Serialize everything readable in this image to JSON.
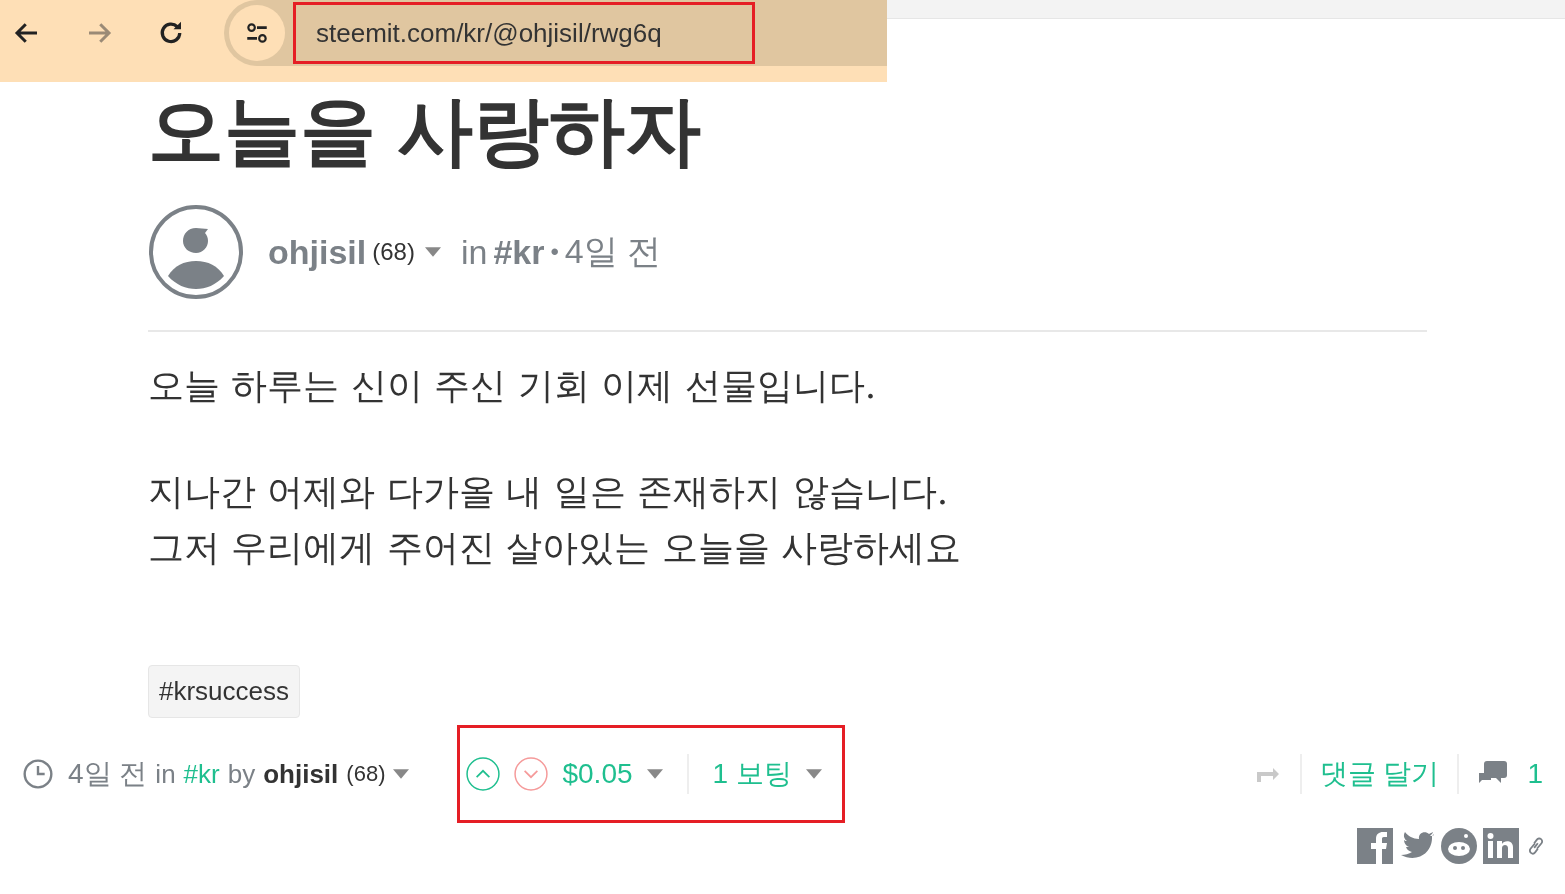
{
  "browser": {
    "url": "steemit.com/kr/@ohjisil/rwg6q",
    "url_highlighted": true
  },
  "post": {
    "title": "오늘을 사랑하자",
    "author": "ohjisil",
    "reputation": "(68)",
    "in": "in",
    "category": "#kr",
    "dot": "•",
    "time": "4일 전",
    "paragraphs": [
      [
        "오늘 하루는 신이 주신 기회 이제 선물입니다."
      ],
      [
        "지나간 어제와 다가올 내 일은 존재하지 않습니다.",
        "그저 우리에게 주어진 살아있는 오늘을 사랑하세요"
      ]
    ],
    "tags": [
      "#krsuccess"
    ]
  },
  "footer": {
    "time": "4일 전",
    "in": "in",
    "category": "#kr",
    "by": "by",
    "author": "ohjisil",
    "reputation": "(68)",
    "payout": "$0.05",
    "votes": "1 보팅",
    "reply": "댓글 달기",
    "comments": "1",
    "voting_highlighted": true
  }
}
